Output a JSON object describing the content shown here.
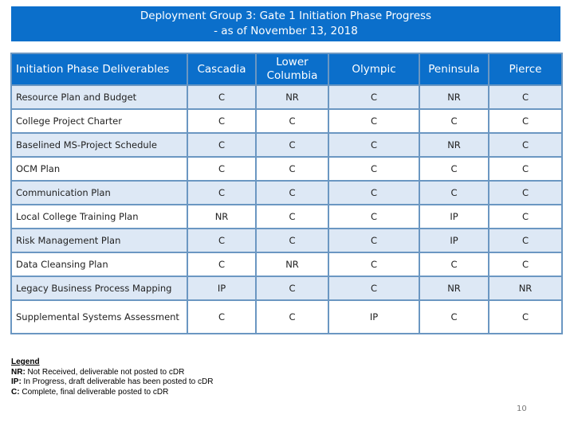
{
  "title": {
    "line1": "Deployment Group 3:  Gate 1 Initiation Phase Progress",
    "line2": "- as of November 13, 2018"
  },
  "colors": {
    "header_blue": "#0b6fcb",
    "alt_row": "#dde8f5",
    "border": "#6b97c2"
  },
  "table": {
    "headers": [
      "Initiation Phase Deliverables",
      "Cascadia",
      "Lower Columbia",
      "Olympic",
      "Peninsula",
      "Pierce"
    ],
    "rows": [
      {
        "deliverable": "Resource Plan and Budget",
        "values": [
          "C",
          "NR",
          "C",
          "NR",
          "C"
        ]
      },
      {
        "deliverable": "College Project Charter",
        "values": [
          "C",
          "C",
          "C",
          "C",
          "C"
        ]
      },
      {
        "deliverable": "Baselined MS-Project Schedule",
        "values": [
          "C",
          "C",
          "C",
          "NR",
          "C"
        ]
      },
      {
        "deliverable": "OCM Plan",
        "values": [
          "C",
          "C",
          "C",
          "C",
          "C"
        ]
      },
      {
        "deliverable": "Communication Plan",
        "values": [
          "C",
          "C",
          "C",
          "C",
          "C"
        ]
      },
      {
        "deliverable": "Local College Training Plan",
        "values": [
          "NR",
          "C",
          "C",
          "IP",
          "C"
        ]
      },
      {
        "deliverable": "Risk Management Plan",
        "values": [
          "C",
          "C",
          "C",
          "IP",
          "C"
        ]
      },
      {
        "deliverable": "Data Cleansing Plan",
        "values": [
          "C",
          "NR",
          "C",
          "C",
          "C"
        ]
      },
      {
        "deliverable": "Legacy Business Process Mapping",
        "values": [
          "IP",
          "C",
          "C",
          "NR",
          "NR"
        ]
      },
      {
        "deliverable": "Supplemental Systems Assessment",
        "values": [
          "C",
          "C",
          "IP",
          "C",
          "C"
        ]
      }
    ]
  },
  "legend": {
    "title": "Legend",
    "items": [
      {
        "code": "NR:",
        "text": " Not Received, deliverable not posted to cDR"
      },
      {
        "code": "IP:",
        "text": " In Progress, draft deliverable has been posted to cDR"
      },
      {
        "code": "C:",
        "text": " Complete, final deliverable posted to cDR"
      }
    ]
  },
  "page_number": "10"
}
